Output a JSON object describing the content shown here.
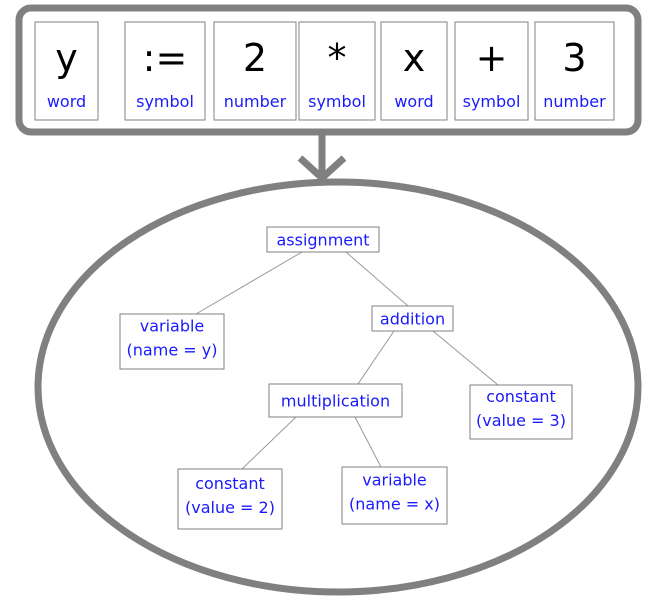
{
  "colors": {
    "frame": "#808080",
    "label": "#1a1aff",
    "box_border": "#808080",
    "edge": "#999999"
  },
  "tokens": [
    {
      "text": "y",
      "kind": "word"
    },
    {
      "text": ":=",
      "kind": "symbol"
    },
    {
      "text": "2",
      "kind": "number"
    },
    {
      "text": "*",
      "kind": "symbol"
    },
    {
      "text": "x",
      "kind": "word"
    },
    {
      "text": "+",
      "kind": "symbol"
    },
    {
      "text": "3",
      "kind": "number"
    }
  ],
  "tree": {
    "nodes": [
      {
        "id": "assignment",
        "lines": [
          "assignment"
        ]
      },
      {
        "id": "var-y",
        "lines": [
          "variable",
          "(name = y)"
        ]
      },
      {
        "id": "addition",
        "lines": [
          "addition"
        ]
      },
      {
        "id": "multiplication",
        "lines": [
          "multiplication"
        ]
      },
      {
        "id": "const-3",
        "lines": [
          "constant",
          "(value = 3)"
        ]
      },
      {
        "id": "const-2",
        "lines": [
          "constant",
          "(value = 2)"
        ]
      },
      {
        "id": "var-x",
        "lines": [
          "variable",
          "(name = x)"
        ]
      }
    ],
    "edges": [
      [
        "assignment",
        "var-y"
      ],
      [
        "assignment",
        "addition"
      ],
      [
        "addition",
        "multiplication"
      ],
      [
        "addition",
        "const-3"
      ],
      [
        "multiplication",
        "const-2"
      ],
      [
        "multiplication",
        "var-x"
      ]
    ]
  }
}
